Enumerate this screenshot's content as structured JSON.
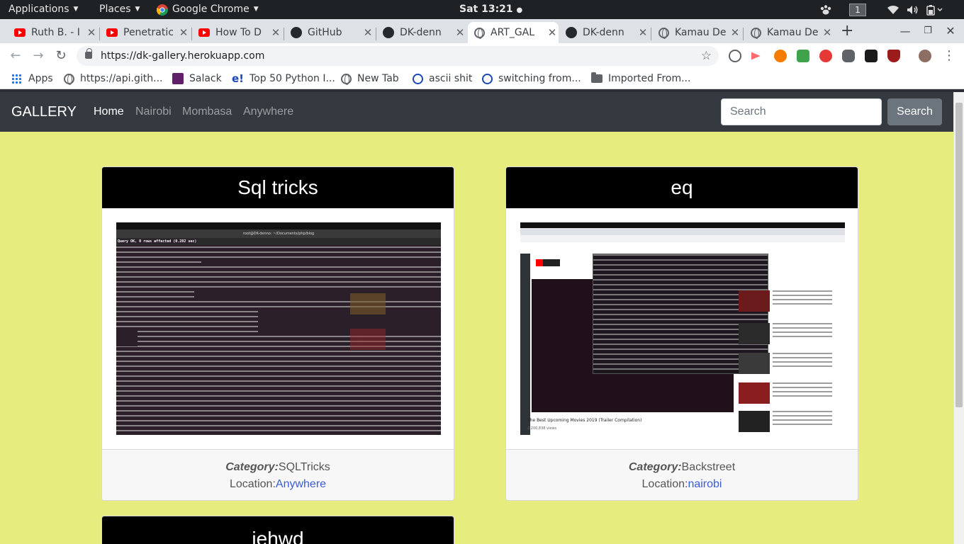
{
  "topbar": {
    "applications": "Applications",
    "places": "Places",
    "app_name": "Google Chrome",
    "clock": "Sat 13:21",
    "workspace": "1"
  },
  "tabs": [
    {
      "title": "Ruth B. - I",
      "icon": "youtube-icon"
    },
    {
      "title": "Penetratic",
      "icon": "youtube-icon"
    },
    {
      "title": "How To D",
      "icon": "youtube-icon"
    },
    {
      "title": "GitHub",
      "icon": "github-icon"
    },
    {
      "title": "DK-denn",
      "icon": "github-icon"
    },
    {
      "title": "ART_GAL",
      "icon": "globe-icon"
    },
    {
      "title": "DK-denn",
      "icon": "github-icon"
    },
    {
      "title": "Kamau De",
      "icon": "globe-icon"
    },
    {
      "title": "Kamau De",
      "icon": "globe-icon"
    }
  ],
  "toolbar": {
    "url": "https://dk-gallery.herokuapp.com"
  },
  "bookmarks": [
    {
      "label": "Apps"
    },
    {
      "label": "https://api.gith..."
    },
    {
      "label": "Salack"
    },
    {
      "label": "Top 50 Python I..."
    },
    {
      "label": "New Tab"
    },
    {
      "label": "ascii shit"
    },
    {
      "label": "switching from..."
    },
    {
      "label": "Imported From..."
    }
  ],
  "page": {
    "brand": "GALLERY",
    "nav": [
      "Home",
      "Nairobi",
      "Mombasa",
      "Anywhere"
    ],
    "search_placeholder": "Search",
    "search_button": "Search",
    "category_label": "Category:",
    "location_label": "Location:",
    "cards": [
      {
        "title": "Sql tricks",
        "category": "SQLTricks",
        "location": "Anywhere"
      },
      {
        "title": "eq",
        "category": "Backstreet",
        "location": "nairobi"
      },
      {
        "title": "iehwd"
      }
    ]
  },
  "thumbs": {
    "sql_tricks": {
      "title_bar": "root@DK-denno: ~/Documents/php/blog",
      "status": "Query OK, 0 rows affected (0.282 sec)"
    },
    "eq": {
      "video_title": "The Best Upcoming Movies 2019 (Trailer Compilation)",
      "views": "2,200,838 views"
    }
  },
  "colors": {
    "page_bg": "#e7ec7e",
    "navbar_bg": "#343a40",
    "card_header_bg": "#000000",
    "link": "#3b5bdb"
  }
}
